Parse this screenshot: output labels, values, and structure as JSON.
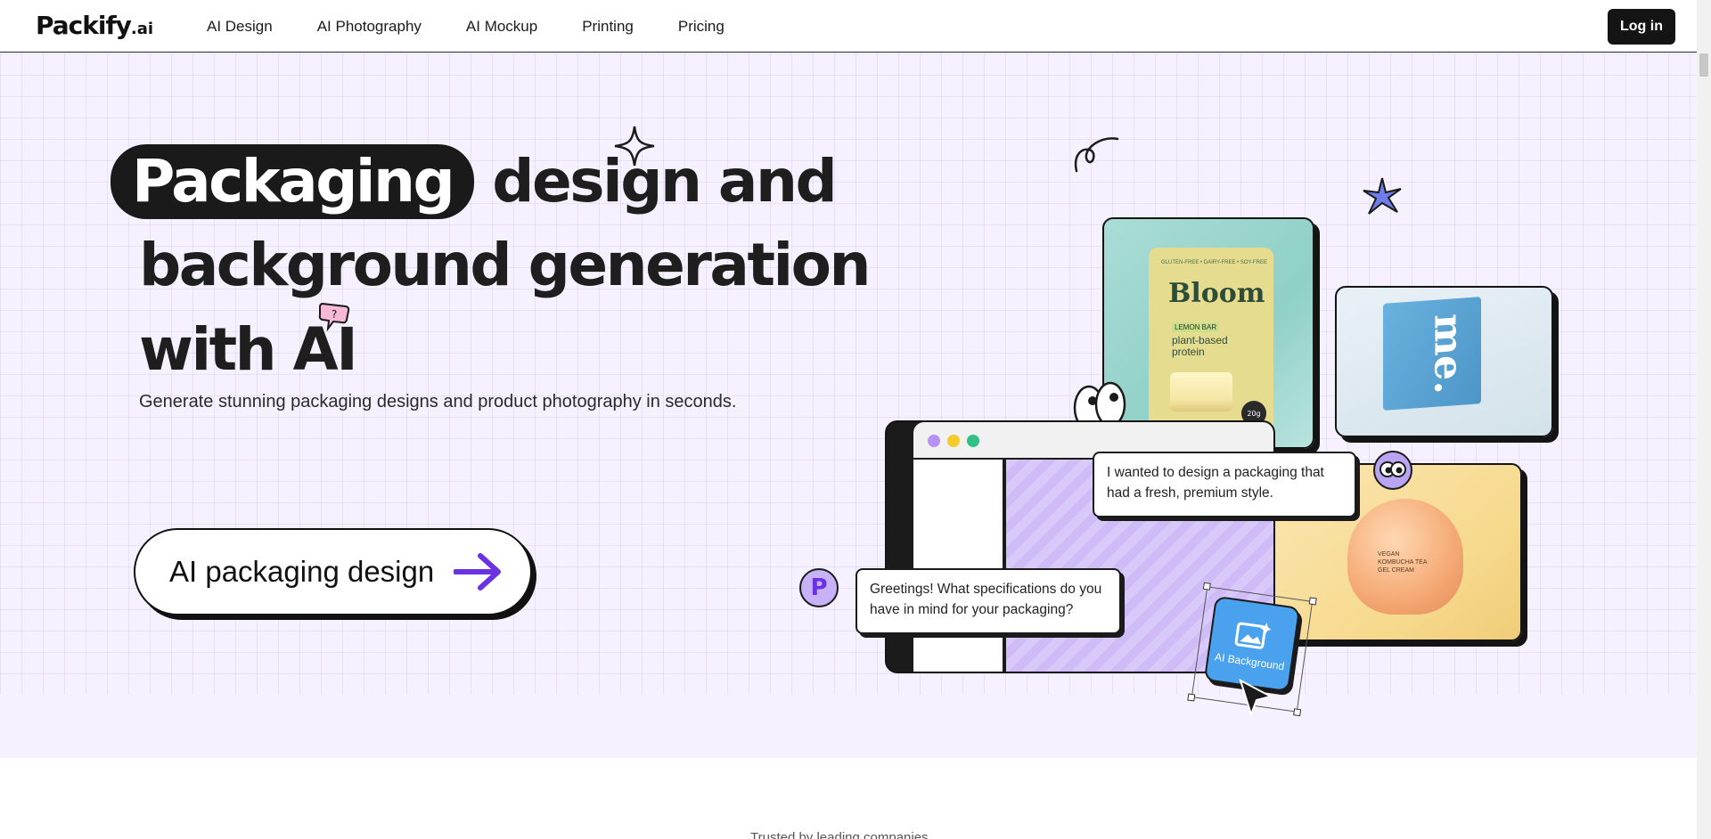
{
  "header": {
    "logo": "Packify",
    "logo_suffix": ".ai",
    "nav": [
      "AI Design",
      "AI Photography",
      "AI Mockup",
      "Printing",
      "Pricing"
    ],
    "login_label": "Log in"
  },
  "hero": {
    "headline_pill": "Packaging",
    "headline_line1_rest": "design and",
    "headline_line2": "background generation",
    "headline_line3": "with AI",
    "subtitle": "Generate stunning packaging designs and product photography in seconds.",
    "cta_label": "AI packaging design"
  },
  "collage": {
    "bloom_card": {
      "small_text": "GLUTEN-FREE • DAIRY-FREE • SOY-FREE",
      "brand": "Bloom",
      "tag": "LEMON BAR",
      "product": "plant-based protein",
      "badge": "20g"
    },
    "box_card": {
      "brand": "me."
    },
    "cream_card": {
      "label": "VEGAN KOMBUCHA TEA GEL CREAM"
    },
    "chat_user": "I wanted to design a packaging that had a fresh, premium style.",
    "chat_bot": "Greetings! What specifications do you have in mind for your packaging?",
    "avatar_letter": "P",
    "ai_background_label": "AI Background",
    "window_dots": [
      "#b792f5",
      "#f4cb2a",
      "#2fc186"
    ]
  },
  "below_fold": {
    "caption": "Trusted by leading companies"
  },
  "colors": {
    "accent_purple": "#6a32e0",
    "hero_bg": "#f6f1fe",
    "dark": "#141414"
  }
}
